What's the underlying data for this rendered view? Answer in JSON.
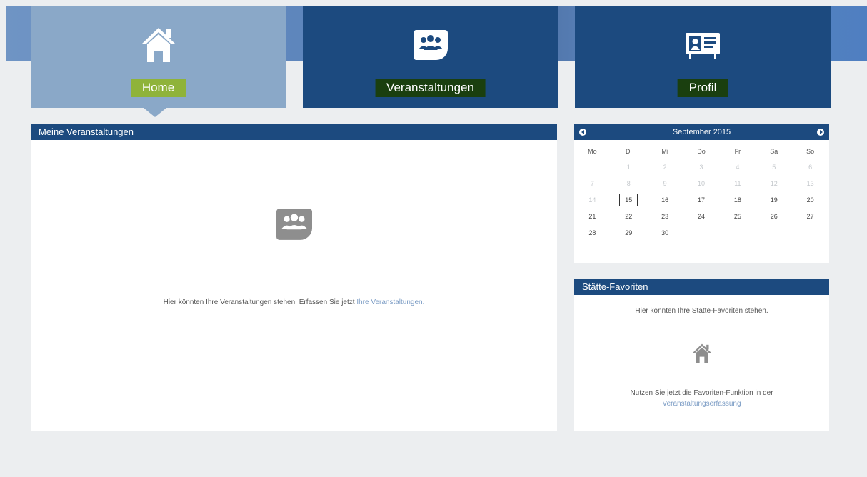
{
  "nav": {
    "tiles": [
      {
        "label": "Home",
        "icon": "home-icon",
        "active": true
      },
      {
        "label": "Veranstaltungen",
        "icon": "group-icon",
        "active": false
      },
      {
        "label": "Profil",
        "icon": "id-card-icon",
        "active": false
      }
    ]
  },
  "events_panel": {
    "title": "Meine Veranstaltungen",
    "empty_icon": "group-icon",
    "empty_text": "Hier könnten Ihre Veranstaltungen stehen. Erfassen Sie jetzt",
    "empty_link": "Ihre Veranstaltungen."
  },
  "calendar": {
    "month_label": "September 2015",
    "weekdays": [
      "Mo",
      "Di",
      "Mi",
      "Do",
      "Fr",
      "Sa",
      "So"
    ],
    "weeks": [
      [
        "",
        "1",
        "2",
        "3",
        "4",
        "5",
        "6"
      ],
      [
        "7",
        "8",
        "9",
        "10",
        "11",
        "12",
        "13"
      ],
      [
        "14",
        "15",
        "16",
        "17",
        "18",
        "19",
        "20"
      ],
      [
        "21",
        "22",
        "23",
        "24",
        "25",
        "26",
        "27"
      ],
      [
        "28",
        "29",
        "30",
        "",
        "",
        "",
        ""
      ]
    ],
    "today": "15",
    "past_until": 14
  },
  "favorites_panel": {
    "title": "Stätte-Favoriten",
    "intro": "Hier könnten Ihre Stätte-Favoriten stehen.",
    "empty_icon": "home-icon",
    "hint": "Nutzen Sie jetzt die Favoriten-Funktion in der",
    "hint_link": "Veranstaltungserfassung"
  },
  "colors": {
    "primary": "#1c4a7f",
    "active_tile": "#8aa8c8",
    "active_label": "#8fb33a",
    "link": "#7a9bc4"
  }
}
